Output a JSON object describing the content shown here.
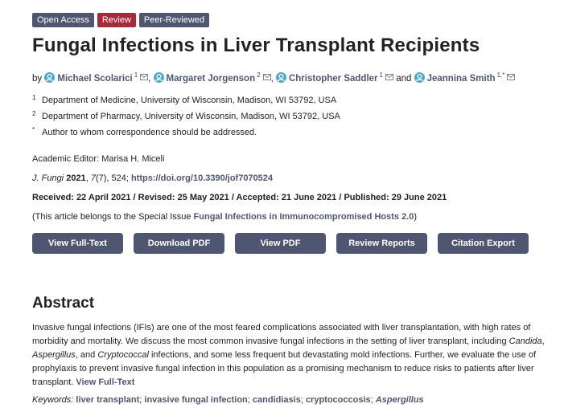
{
  "badges": {
    "open_access": "Open Access",
    "review": "Review",
    "peer_reviewed": "Peer-Reviewed"
  },
  "title": "Fungal Infections in Liver Transplant Recipients",
  "authors": {
    "by": "by",
    "list": [
      {
        "name": "Michael Scolarici",
        "sup": "1"
      },
      {
        "name": "Margaret Jorgenson",
        "sup": "2"
      },
      {
        "name": "Christopher Saddler",
        "sup": "1"
      },
      {
        "name": "Jeannina Smith",
        "sup": "1,*"
      }
    ],
    "comma": ",",
    "and": "and"
  },
  "affiliations": [
    {
      "num": "1",
      "text": "Department of Medicine, University of Wisconsin, Madison, WI 53792, USA"
    },
    {
      "num": "2",
      "text": "Department of Pharmacy, University of Wisconsin, Madison, WI 53792, USA"
    },
    {
      "num": "*",
      "text": "Author to whom correspondence should be addressed."
    }
  ],
  "editor": "Academic Editor: Marisa H. Miceli",
  "citation": {
    "journal": "J. Fungi",
    "year": "2021",
    "volume": "7",
    "issue_pages": "(7), 524; ",
    "doi": "https://doi.org/10.3390/jof7070524"
  },
  "dates": "Received: 22 April 2021 / Revised: 25 May 2021 / Accepted: 21 June 2021 / Published: 29 June 2021",
  "special_issue": {
    "prefix": "(This article belongs to the Special Issue ",
    "link": "Fungal Infections in Immunocompromised Hosts 2.0",
    "suffix": ")"
  },
  "buttons": {
    "full_text": "View Full-Text",
    "download_pdf": "Download PDF",
    "view_pdf": "View PDF",
    "review_reports": "Review Reports",
    "citation_export": "Citation Export"
  },
  "abstract": {
    "heading": "Abstract",
    "part1": "Invasive fungal infections (IFIs) are one of the most feared complications associated with liver transplantation, with high rates of morbidity and mortality. We discuss the most common invasive fungal infections in the setting of liver transplant, including ",
    "candida": "Candida",
    "sep1": ", ",
    "aspergillus": "Aspergillus",
    "sep2": ", and ",
    "cryptococcal": "Cryptococcal",
    "part2": " infections, and some less frequent but devastating mold infections. Further, we evaluate the use of prophylaxis to prevent invasive fungal infection in this population as a promising mechanism to reduce risks to patients after liver transplant. ",
    "full_text_link": "View Full-Text"
  },
  "keywords": {
    "label": "Keywords:",
    "items": [
      "liver transplant",
      "invasive fungal infection",
      "candidiasis",
      "cryptococcosis",
      "Aspergillus"
    ],
    "separator": "; "
  }
}
